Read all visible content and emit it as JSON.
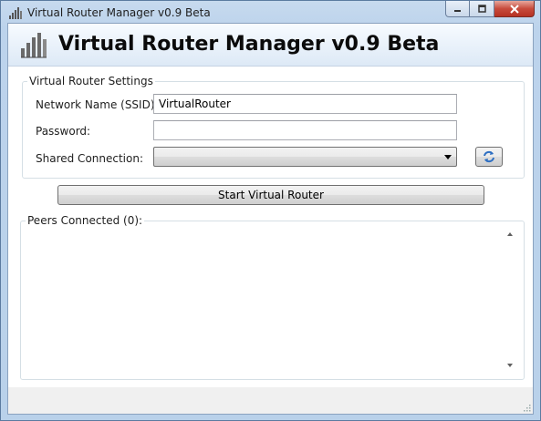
{
  "window": {
    "title": "Virtual Router Manager v0.9 Beta"
  },
  "header": {
    "title": "Virtual Router Manager v0.9 Beta"
  },
  "settings": {
    "group_label": "Virtual Router Settings",
    "ssid_label": "Network Name (SSID):",
    "ssid_value": "VirtualRouter",
    "password_label": "Password:",
    "password_value": "",
    "shared_label": "Shared Connection:",
    "shared_value": ""
  },
  "actions": {
    "start_label": "Start Virtual Router"
  },
  "peers": {
    "label": "Peers Connected (0):"
  },
  "icons": {
    "app": "signal-bars-icon",
    "refresh": "refresh-icon"
  },
  "colors": {
    "titlebar": "#bcd3ec",
    "close_button": "#c74b3c",
    "refresh_arrows": "#2e6fc2"
  }
}
